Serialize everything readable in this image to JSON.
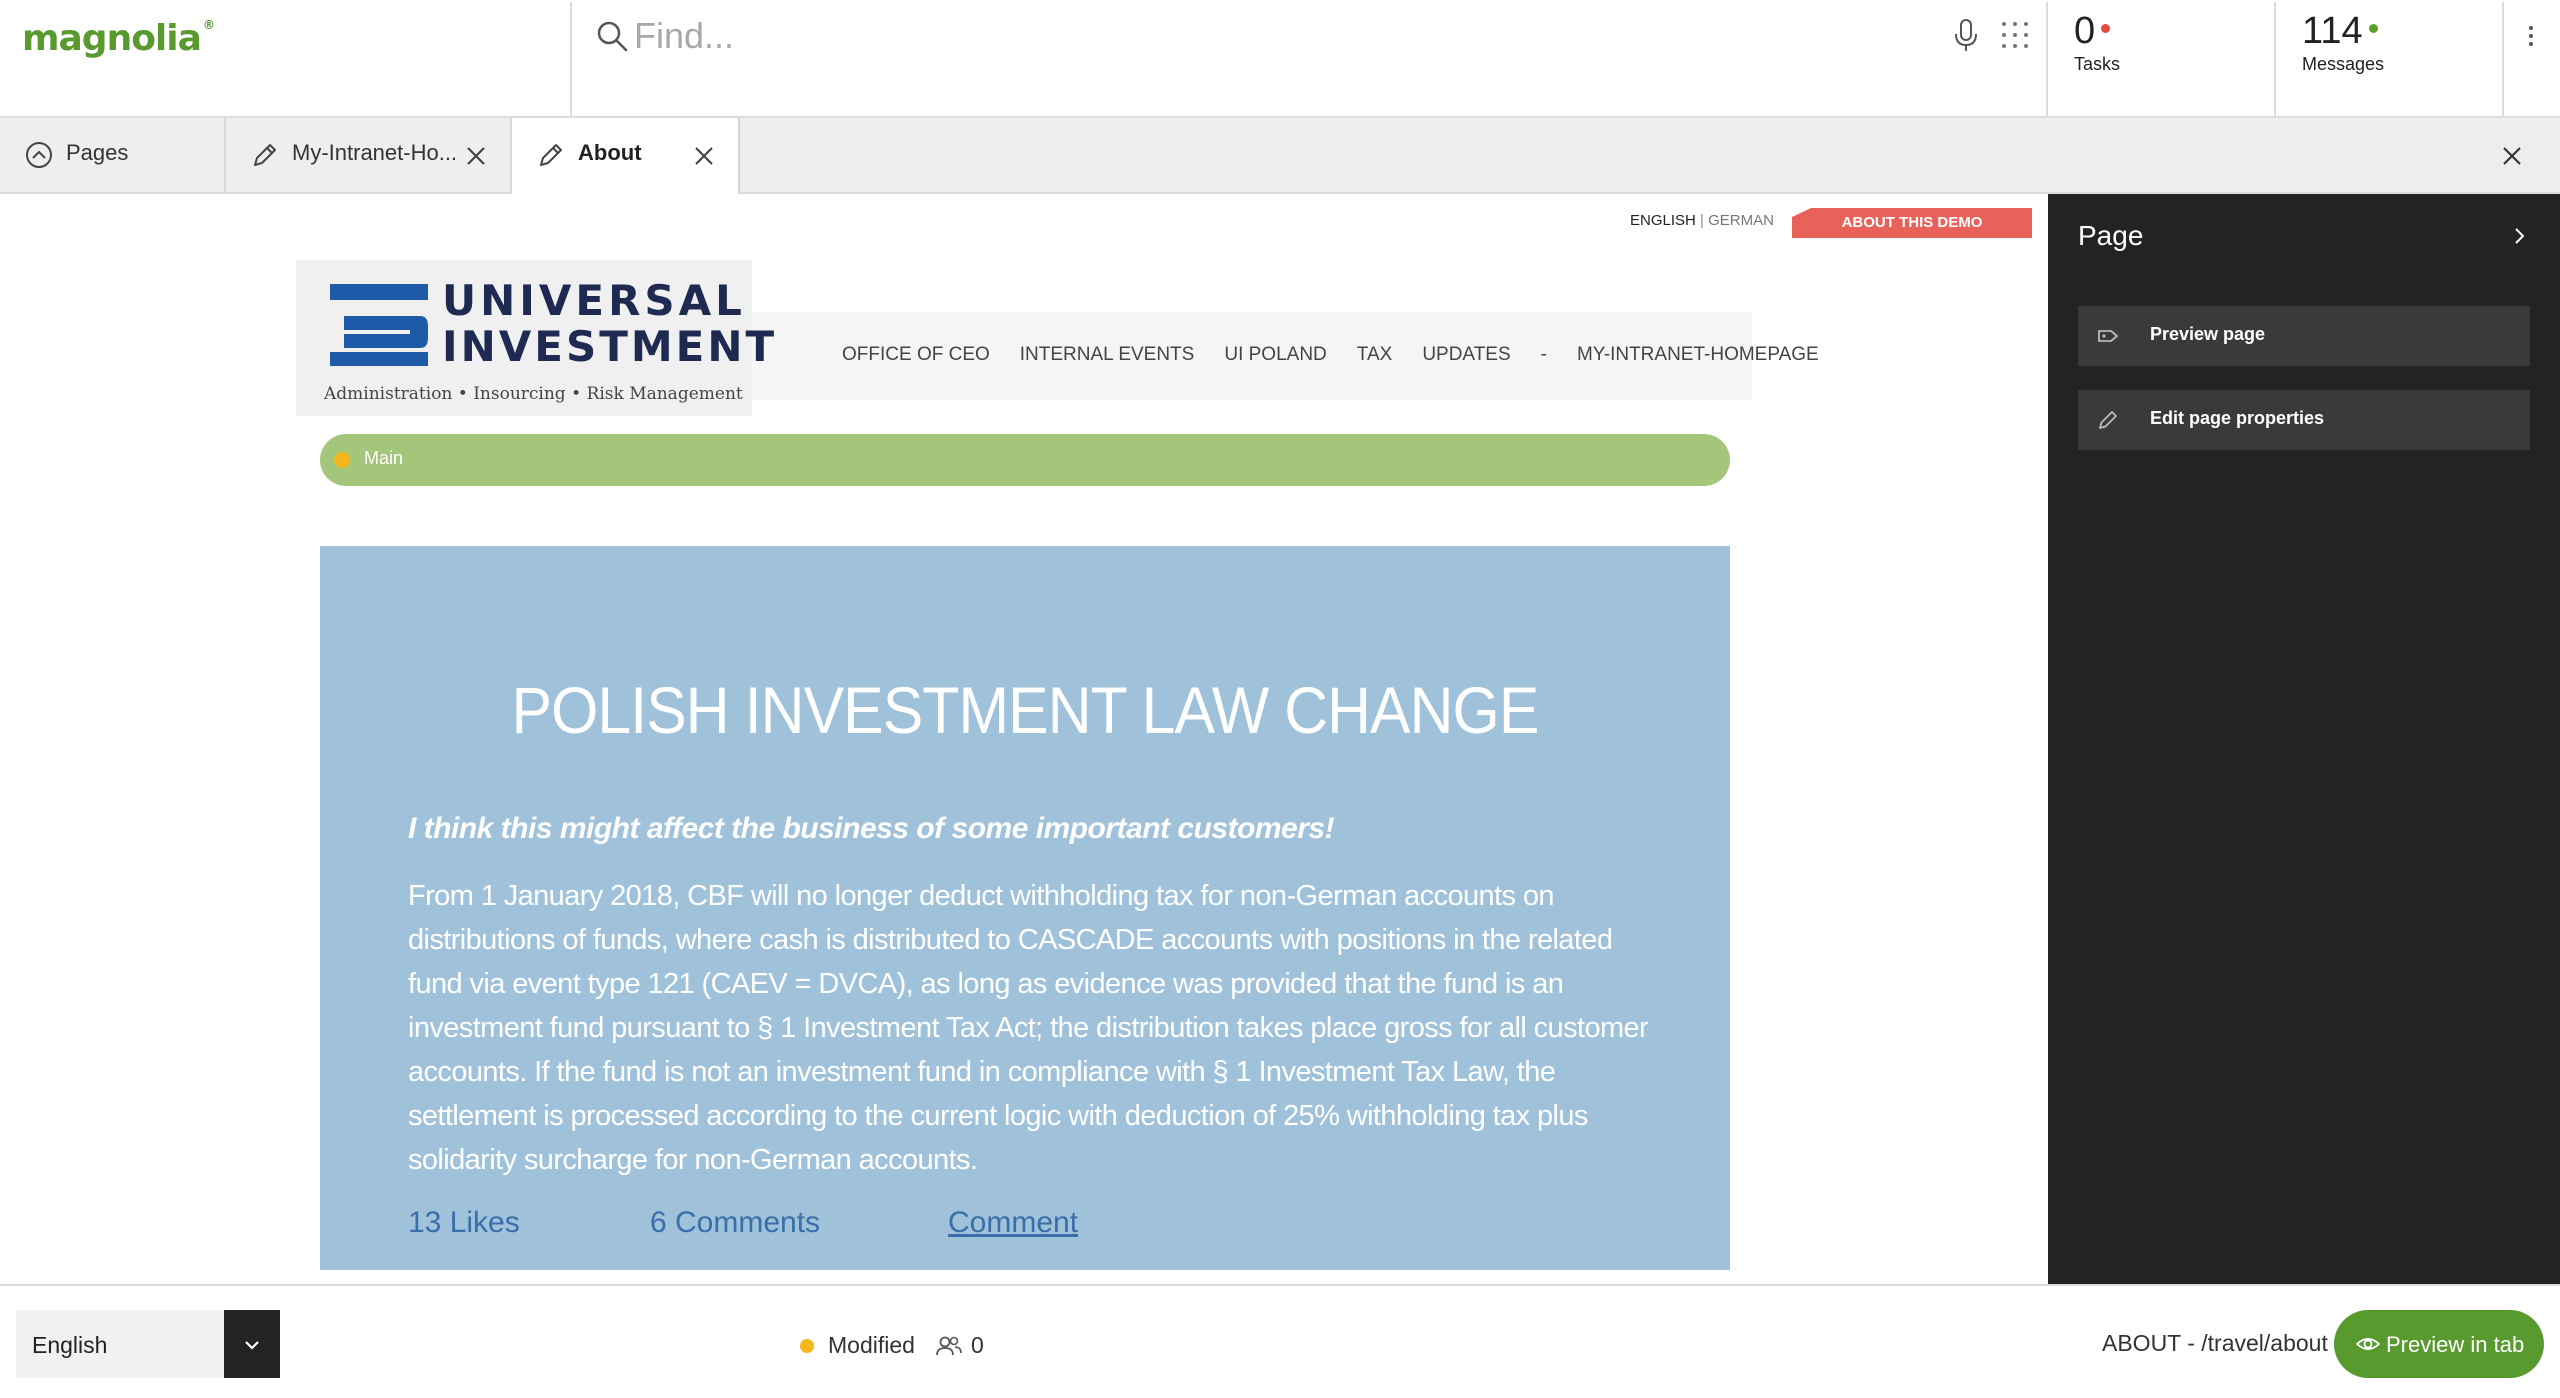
{
  "app": {
    "logo_text": "magnolia",
    "logo_mark": "®"
  },
  "search": {
    "placeholder": "Find..."
  },
  "counters": {
    "tasks_count": "0",
    "tasks_label": "Tasks",
    "tasks_dot_color": "#e8483f",
    "messages_count": "114",
    "messages_label": "Messages",
    "messages_dot_color": "#5aa02c"
  },
  "tabs": [
    {
      "label": "Pages",
      "icon": "chevron-up-circle-icon",
      "closable": false
    },
    {
      "label": "My-Intranet-Ho...",
      "icon": "pencil-icon",
      "closable": true
    },
    {
      "label": "About",
      "icon": "pencil-icon",
      "closable": true,
      "active": true
    }
  ],
  "site": {
    "lang_current": "ENGLISH",
    "lang_sep": "|",
    "lang_alt": "GERMAN",
    "about_demo": "ABOUT THIS DEMO",
    "logo_line1": "UNIVERSAL",
    "logo_line2": "INVESTMENT",
    "logo_tagline": "Administration • Insourcing • Risk Management",
    "nav": [
      "OFFICE OF CEO",
      "INTERNAL EVENTS",
      "UI POLAND",
      "TAX",
      "UPDATES",
      "-",
      "MY-INTRANET-HOMEPAGE"
    ],
    "area_label": "Main"
  },
  "article": {
    "title": "POLISH INVESTMENT LAW CHANGE",
    "lead": "I think this might affect the business of some important customers!",
    "body": "From 1 January 2018, CBF will no longer deduct withholding tax for non-German accounts on distributions of funds, where cash is distributed to CASCADE accounts with positions in the related fund via event type 121 (CAEV = DVCA), as long as evidence was provided that the fund is an investment fund pursuant to § 1 Investment Tax Act; the distribution takes place gross for all customer accounts. If the fund is not an investment fund in compliance with § 1 Investment Tax Law, the settlement is processed according to the current logic with deduction of 25% withholding tax plus solidarity surcharge for non-German accounts.",
    "likes": "13 Likes",
    "comments": "6 Comments",
    "comment_link": "Comment"
  },
  "panel": {
    "title": "Page",
    "actions": [
      {
        "label": "Preview page",
        "icon": "tag-icon"
      },
      {
        "label": "Edit page properties",
        "icon": "pencil-icon"
      }
    ]
  },
  "footer": {
    "language": "English",
    "status": "Modified",
    "collaborators": "0",
    "path": "ABOUT - /travel/about",
    "preview_button": "Preview in tab"
  },
  "colors": {
    "brand_green": "#599a2f",
    "area_bar": "#a3c67b",
    "article_bg": "#9fc1da",
    "demo_ribbon": "#e8625a",
    "panel_bg": "#232323",
    "status_dot": "#f5b61c"
  }
}
